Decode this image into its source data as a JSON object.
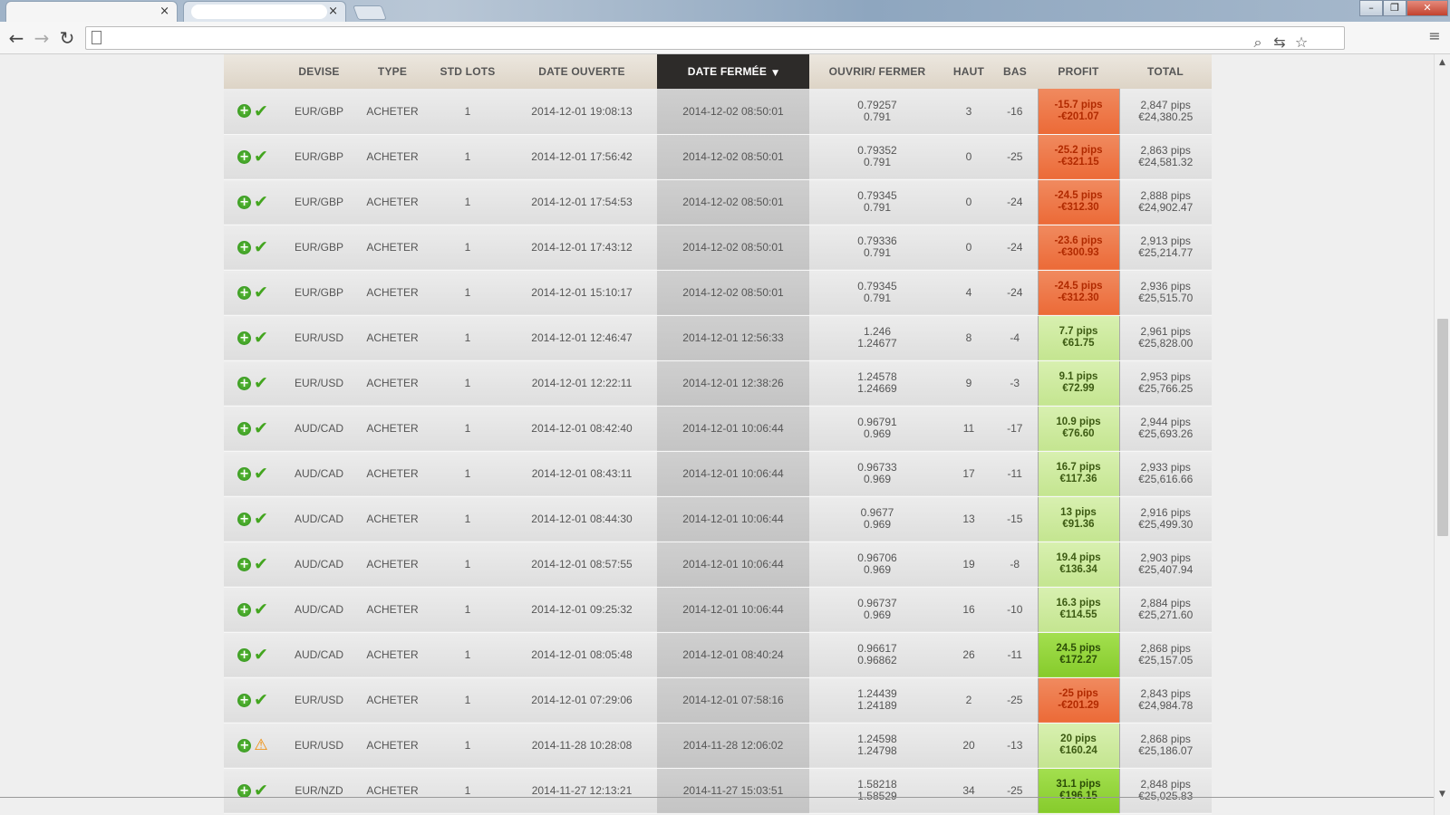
{
  "browser": {
    "tabs": [
      {
        "label": "",
        "close": "×"
      },
      {
        "label": "",
        "close": "×"
      }
    ],
    "window_controls": {
      "minimize": "–",
      "maximize": "❐",
      "close": "✕"
    },
    "nav": {
      "back": "←",
      "forward": "→",
      "reload": "↻"
    },
    "address": "",
    "icons": {
      "zoom": "⌕",
      "translate": "⇆",
      "star": "☆",
      "menu": "≡"
    }
  },
  "table": {
    "headers": {
      "devise": "DEVISE",
      "type": "TYPE",
      "lots": "STD LOTS",
      "opened": "DATE OUVERTE",
      "closed": "DATE FERMÉE",
      "open_close": "OUVRIR/ FERMER",
      "high": "HAUT",
      "low": "BAS",
      "profit": "PROFIT",
      "total": "TOTAL"
    },
    "sort_indicator": "▼",
    "rows": [
      {
        "status": "ok",
        "devise": "EUR/GBP",
        "type": "ACHETER",
        "lots": "1",
        "opened": "2014-12-01 19:08:13",
        "closed": "2014-12-02 08:50:01",
        "open": "0.79257",
        "close": "0.791",
        "high": "3",
        "low": "-16",
        "pips": "-15.7 pips",
        "eur": "-€201.07",
        "kind": "loss",
        "total_pips": "2,847 pips",
        "total_eur": "€24,380.25"
      },
      {
        "status": "ok",
        "devise": "EUR/GBP",
        "type": "ACHETER",
        "lots": "1",
        "opened": "2014-12-01 17:56:42",
        "closed": "2014-12-02 08:50:01",
        "open": "0.79352",
        "close": "0.791",
        "high": "0",
        "low": "-25",
        "pips": "-25.2 pips",
        "eur": "-€321.15",
        "kind": "loss",
        "total_pips": "2,863 pips",
        "total_eur": "€24,581.32"
      },
      {
        "status": "ok",
        "devise": "EUR/GBP",
        "type": "ACHETER",
        "lots": "1",
        "opened": "2014-12-01 17:54:53",
        "closed": "2014-12-02 08:50:01",
        "open": "0.79345",
        "close": "0.791",
        "high": "0",
        "low": "-24",
        "pips": "-24.5 pips",
        "eur": "-€312.30",
        "kind": "loss",
        "total_pips": "2,888 pips",
        "total_eur": "€24,902.47"
      },
      {
        "status": "ok",
        "devise": "EUR/GBP",
        "type": "ACHETER",
        "lots": "1",
        "opened": "2014-12-01 17:43:12",
        "closed": "2014-12-02 08:50:01",
        "open": "0.79336",
        "close": "0.791",
        "high": "0",
        "low": "-24",
        "pips": "-23.6 pips",
        "eur": "-€300.93",
        "kind": "loss",
        "total_pips": "2,913 pips",
        "total_eur": "€25,214.77"
      },
      {
        "status": "ok",
        "devise": "EUR/GBP",
        "type": "ACHETER",
        "lots": "1",
        "opened": "2014-12-01 15:10:17",
        "closed": "2014-12-02 08:50:01",
        "open": "0.79345",
        "close": "0.791",
        "high": "4",
        "low": "-24",
        "pips": "-24.5 pips",
        "eur": "-€312.30",
        "kind": "loss",
        "total_pips": "2,936 pips",
        "total_eur": "€25,515.70"
      },
      {
        "status": "ok",
        "devise": "EUR/USD",
        "type": "ACHETER",
        "lots": "1",
        "opened": "2014-12-01 12:46:47",
        "closed": "2014-12-01 12:56:33",
        "open": "1.246",
        "close": "1.24677",
        "high": "8",
        "low": "-4",
        "pips": "7.7 pips",
        "eur": "€61.75",
        "kind": "gain",
        "total_pips": "2,961 pips",
        "total_eur": "€25,828.00"
      },
      {
        "status": "ok",
        "devise": "EUR/USD",
        "type": "ACHETER",
        "lots": "1",
        "opened": "2014-12-01 12:22:11",
        "closed": "2014-12-01 12:38:26",
        "open": "1.24578",
        "close": "1.24669",
        "high": "9",
        "low": "-3",
        "pips": "9.1 pips",
        "eur": "€72.99",
        "kind": "gain",
        "total_pips": "2,953 pips",
        "total_eur": "€25,766.25"
      },
      {
        "status": "ok",
        "devise": "AUD/CAD",
        "type": "ACHETER",
        "lots": "1",
        "opened": "2014-12-01 08:42:40",
        "closed": "2014-12-01 10:06:44",
        "open": "0.96791",
        "close": "0.969",
        "high": "11",
        "low": "-17",
        "pips": "10.9 pips",
        "eur": "€76.60",
        "kind": "gain",
        "total_pips": "2,944 pips",
        "total_eur": "€25,693.26"
      },
      {
        "status": "ok",
        "devise": "AUD/CAD",
        "type": "ACHETER",
        "lots": "1",
        "opened": "2014-12-01 08:43:11",
        "closed": "2014-12-01 10:06:44",
        "open": "0.96733",
        "close": "0.969",
        "high": "17",
        "low": "-11",
        "pips": "16.7 pips",
        "eur": "€117.36",
        "kind": "gain",
        "total_pips": "2,933 pips",
        "total_eur": "€25,616.66"
      },
      {
        "status": "ok",
        "devise": "AUD/CAD",
        "type": "ACHETER",
        "lots": "1",
        "opened": "2014-12-01 08:44:30",
        "closed": "2014-12-01 10:06:44",
        "open": "0.9677",
        "close": "0.969",
        "high": "13",
        "low": "-15",
        "pips": "13 pips",
        "eur": "€91.36",
        "kind": "gain",
        "total_pips": "2,916 pips",
        "total_eur": "€25,499.30"
      },
      {
        "status": "ok",
        "devise": "AUD/CAD",
        "type": "ACHETER",
        "lots": "1",
        "opened": "2014-12-01 08:57:55",
        "closed": "2014-12-01 10:06:44",
        "open": "0.96706",
        "close": "0.969",
        "high": "19",
        "low": "-8",
        "pips": "19.4 pips",
        "eur": "€136.34",
        "kind": "gain",
        "total_pips": "2,903 pips",
        "total_eur": "€25,407.94"
      },
      {
        "status": "ok",
        "devise": "AUD/CAD",
        "type": "ACHETER",
        "lots": "1",
        "opened": "2014-12-01 09:25:32",
        "closed": "2014-12-01 10:06:44",
        "open": "0.96737",
        "close": "0.969",
        "high": "16",
        "low": "-10",
        "pips": "16.3 pips",
        "eur": "€114.55",
        "kind": "gain",
        "total_pips": "2,884 pips",
        "total_eur": "€25,271.60"
      },
      {
        "status": "ok",
        "devise": "AUD/CAD",
        "type": "ACHETER",
        "lots": "1",
        "opened": "2014-12-01 08:05:48",
        "closed": "2014-12-01 08:40:24",
        "open": "0.96617",
        "close": "0.96862",
        "high": "26",
        "low": "-11",
        "pips": "24.5 pips",
        "eur": "€172.27",
        "kind": "gainbig",
        "total_pips": "2,868 pips",
        "total_eur": "€25,157.05"
      },
      {
        "status": "ok",
        "devise": "EUR/USD",
        "type": "ACHETER",
        "lots": "1",
        "opened": "2014-12-01 07:29:06",
        "closed": "2014-12-01 07:58:16",
        "open": "1.24439",
        "close": "1.24189",
        "high": "2",
        "low": "-25",
        "pips": "-25 pips",
        "eur": "-€201.29",
        "kind": "loss",
        "total_pips": "2,843 pips",
        "total_eur": "€24,984.78"
      },
      {
        "status": "warn",
        "devise": "EUR/USD",
        "type": "ACHETER",
        "lots": "1",
        "opened": "2014-11-28 10:28:08",
        "closed": "2014-11-28 12:06:02",
        "open": "1.24598",
        "close": "1.24798",
        "high": "20",
        "low": "-13",
        "pips": "20 pips",
        "eur": "€160.24",
        "kind": "gain",
        "total_pips": "2,868 pips",
        "total_eur": "€25,186.07"
      },
      {
        "status": "ok",
        "devise": "EUR/NZD",
        "type": "ACHETER",
        "lots": "1",
        "opened": "2014-11-27 12:13:21",
        "closed": "2014-11-27 15:03:51",
        "open": "1.58218",
        "close": "1.58529",
        "high": "34",
        "low": "-25",
        "pips": "31.1 pips",
        "eur": "€196.15",
        "kind": "gainbig",
        "total_pips": "2,848 pips",
        "total_eur": "€25,025.83"
      }
    ],
    "row_icons": {
      "expand": "+",
      "ok": "✔",
      "warn": "⚠"
    }
  },
  "scrollbar": {
    "up": "▲",
    "down": "▼"
  }
}
